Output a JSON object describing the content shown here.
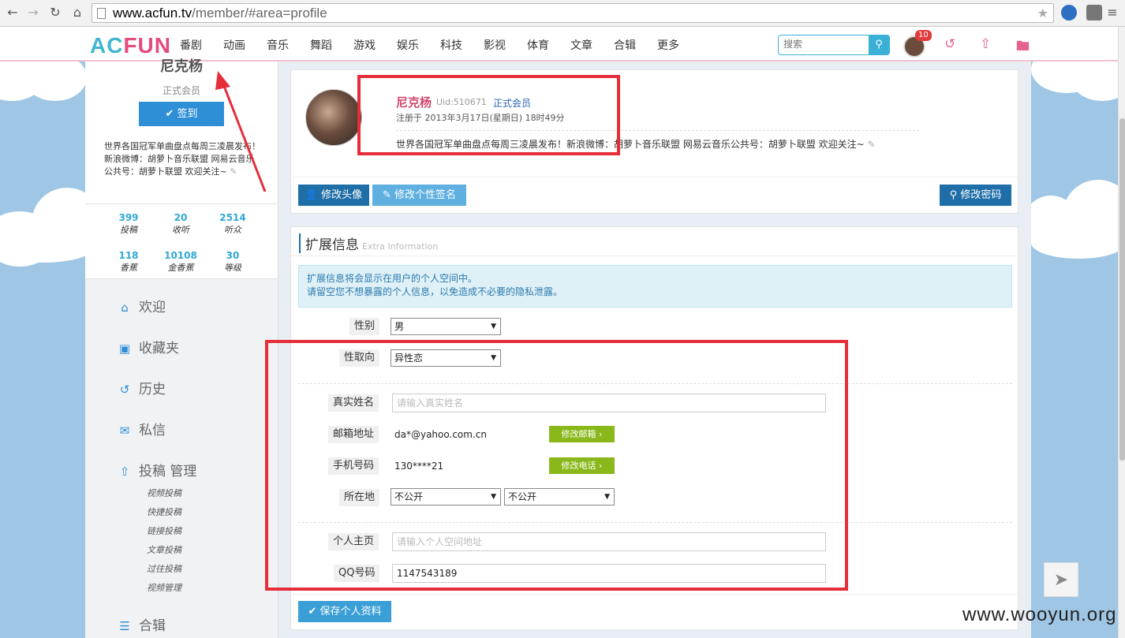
{
  "browser": {
    "url_host": "www.acfun.tv",
    "url_path": "/member/#area=profile"
  },
  "site": {
    "logo_a": "AC",
    "logo_fun": "FUN",
    "nav": [
      "番剧",
      "动画",
      "音乐",
      "舞蹈",
      "游戏",
      "娱乐",
      "科技",
      "影视",
      "体育",
      "文章",
      "合辑",
      "更多"
    ],
    "search_placeholder": "搜索",
    "notification_count": "10",
    "accent_color": "#3ab0d6",
    "brand_pink": "#e24d7f"
  },
  "sidebar": {
    "username": "尼克杨",
    "member_type": "正式会员",
    "sign_button": "签到",
    "bio": "世界各国冠军单曲盘点每周三凌晨发布！新浪微博：胡萝卜音乐联盟 网易云音乐公共号：胡萝卜联盟 欢迎关注~",
    "stats": [
      {
        "value": "399",
        "label": "投稿"
      },
      {
        "value": "20",
        "label": "收听"
      },
      {
        "value": "2514",
        "label": "听众"
      },
      {
        "value": "118",
        "label": "香蕉"
      },
      {
        "value": "10108",
        "label": "金香蕉"
      },
      {
        "value": "30",
        "label": "等级"
      }
    ],
    "menu": [
      "欢迎",
      "收藏夹",
      "历史",
      "私信",
      "投稿 管理",
      "合辑"
    ],
    "submenu": [
      "视频投稿",
      "快捷投稿",
      "链接投稿",
      "文章投稿",
      "过往投稿",
      "视频管理"
    ]
  },
  "profile": {
    "name": "尼克杨",
    "uid": "Uid:510671",
    "member_type": "正式会员",
    "registered": "注册于 2013年3月17日(星期日) 18时49分",
    "signature": "世界各国冠军单曲盘点每周三凌晨发布！新浪微博：胡萝卜音乐联盟  网易云音乐公共号：胡萝卜联盟 欢迎关注~",
    "btn_avatar": "修改头像",
    "btn_signature": "修改个性签名",
    "btn_password": "修改密码"
  },
  "extra": {
    "title": "扩展信息",
    "title_en": "Extra Information",
    "notice_line1": "扩展信息将会显示在用户的个人空间中。",
    "notice_line2": "请留空您不想暴露的个人信息，以免造成不必要的隐私泄露。",
    "gender_label": "性别",
    "gender_value": "男",
    "orientation_label": "性取向",
    "orientation_value": "异性恋",
    "realname_label": "真实姓名",
    "realname_placeholder": "请输入真实姓名",
    "email_label": "邮箱地址",
    "email_value": "da*@yahoo.com.cn",
    "email_button": "修改邮箱 ›",
    "phone_label": "手机号码",
    "phone_value": "130****21",
    "phone_button": "修改电话 ›",
    "location_label": "所在地",
    "location_value1": "不公开",
    "location_value2": "不公开",
    "homepage_label": "个人主页",
    "homepage_placeholder": "请输入个人空间地址",
    "qq_label": "QQ号码",
    "qq_value": "1147543189",
    "save_button": "保存个人资料"
  },
  "watermark": "www.wooyun.org"
}
